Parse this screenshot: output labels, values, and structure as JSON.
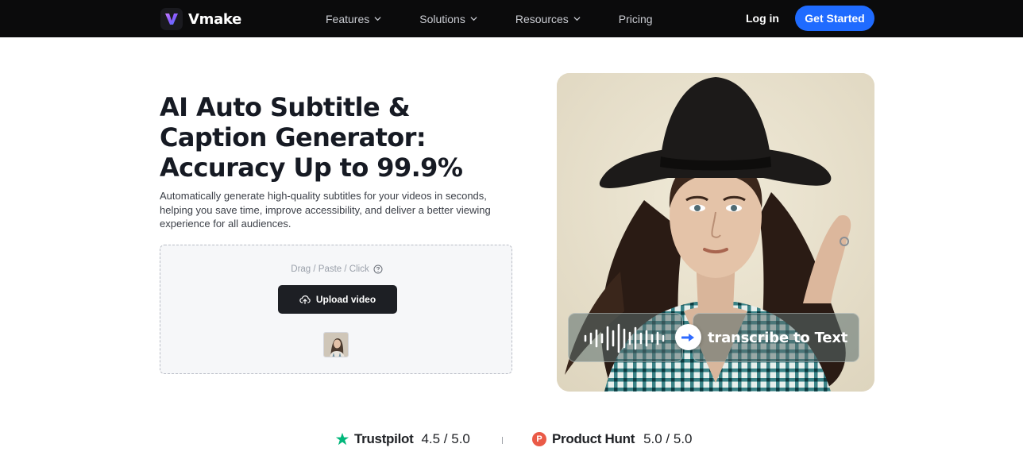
{
  "nav": {
    "brand": "Vmake",
    "items": [
      {
        "label": "Features",
        "has_dropdown": true
      },
      {
        "label": "Solutions",
        "has_dropdown": true
      },
      {
        "label": "Resources",
        "has_dropdown": true
      },
      {
        "label": "Pricing",
        "has_dropdown": false
      }
    ],
    "login": "Log in",
    "cta": "Get Started"
  },
  "hero": {
    "title": "AI Auto Subtitle & Caption Generator: Accuracy Up to 99.9%",
    "description": "Automatically generate high-quality subtitles for your videos in seconds, helping you save time, improve accessibility, and deliver a better viewing experience for all audiences.",
    "upload": {
      "hint": "Drag / Paste / Click",
      "button": "Upload video"
    },
    "overlay_text": "transcribe to Text"
  },
  "ratings": [
    {
      "platform": "Trustpilot",
      "score": "4.5 / 5.0"
    },
    {
      "platform": "Product Hunt",
      "score": "5.0 / 5.0"
    }
  ],
  "colors": {
    "nav_bg": "#0b0b0c",
    "accent": "#1f6bff",
    "upload_button": "#1d1f24",
    "trustpilot_green": "#00b67a",
    "producthunt_red": "#ea5a47"
  }
}
